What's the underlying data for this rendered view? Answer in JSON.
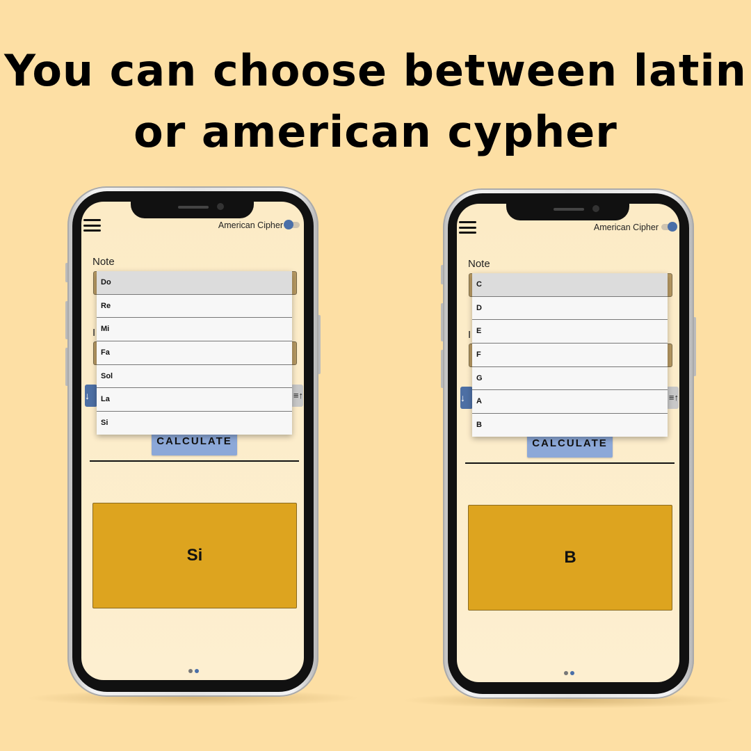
{
  "headline": "You can choose between latin or american cypher",
  "colors": {
    "background": "#FDDFA4",
    "result_box": "#DDA41F",
    "calculate_button": "#8CA8D8",
    "toggle_knob": "#4a6fa8"
  },
  "phones": [
    {
      "toggle_label": "American Cipher",
      "toggle_on": false,
      "note_label": "Note",
      "second_label_partial": "I",
      "calculate_label": "CALCULATE",
      "result": "Si",
      "sort_desc_icon": "sort-descending-icon",
      "sort_asc_icon": "sort-ascending-icon",
      "options": [
        "Do",
        "Re",
        "Mi",
        "Fa",
        "Sol",
        "La",
        "Si"
      ],
      "selected_option": "Do"
    },
    {
      "toggle_label": "American Cipher",
      "toggle_on": true,
      "note_label": "Note",
      "second_label_partial": "I",
      "calculate_label": "CALCULATE",
      "result": "B",
      "sort_desc_icon": "sort-descending-icon",
      "sort_asc_icon": "sort-ascending-icon",
      "options": [
        "C",
        "D",
        "E",
        "F",
        "G",
        "A",
        "B"
      ],
      "selected_option": "C"
    }
  ]
}
